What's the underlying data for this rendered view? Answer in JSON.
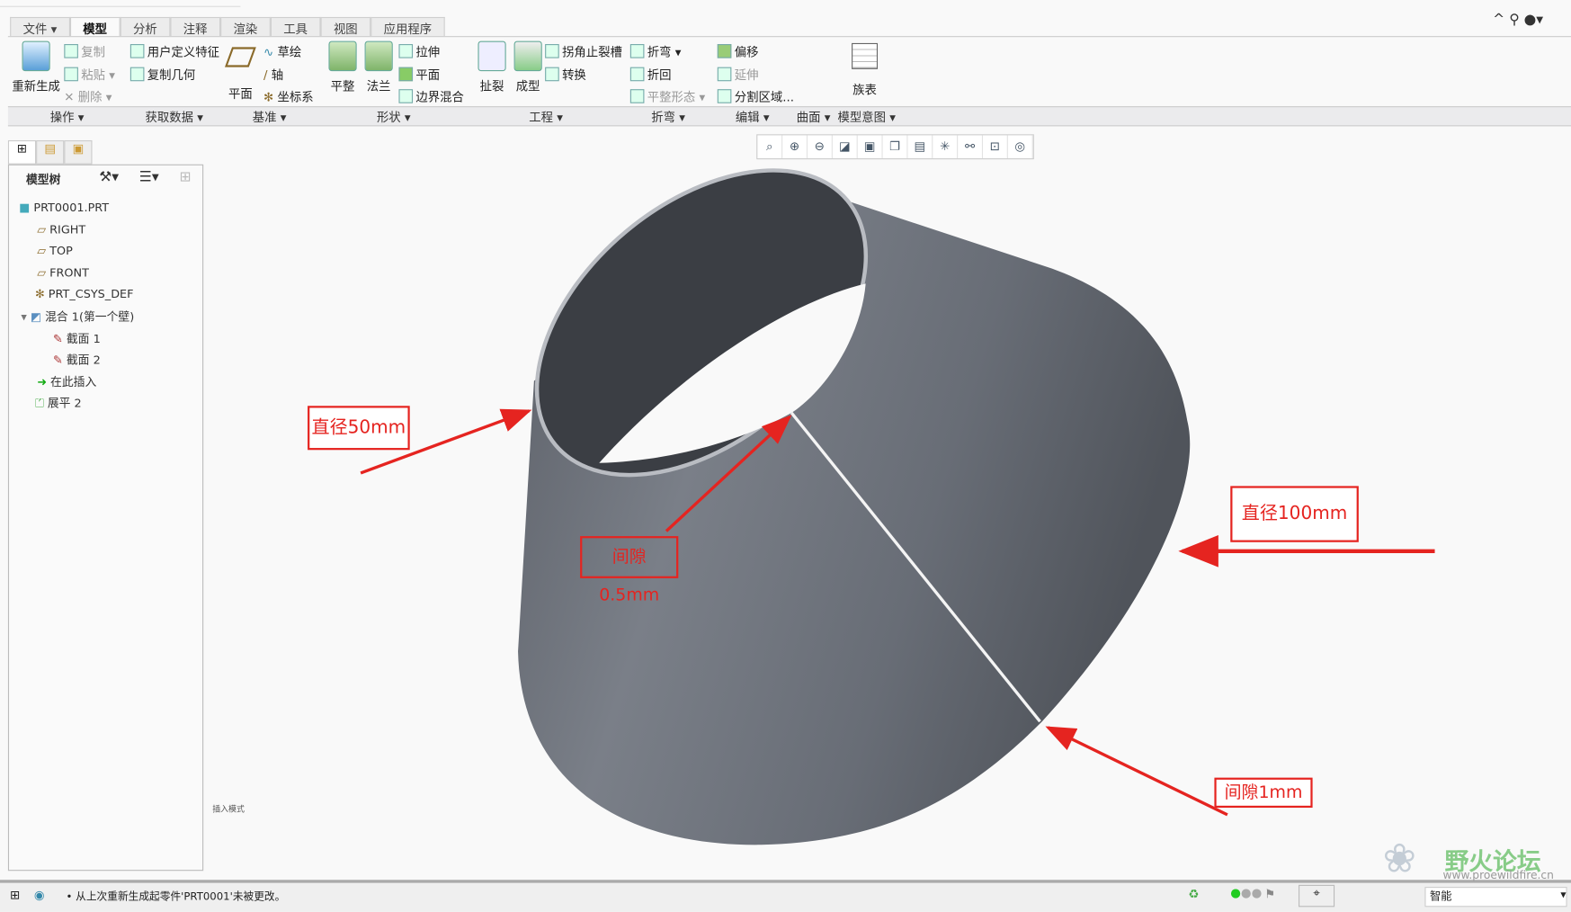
{
  "menu_tabs": [
    {
      "label": "文件 ▾"
    },
    {
      "label": "模型"
    },
    {
      "label": "分析"
    },
    {
      "label": "注释"
    },
    {
      "label": "渲染"
    },
    {
      "label": "工具"
    },
    {
      "label": "视图"
    },
    {
      "label": "应用程序"
    }
  ],
  "ribbon": {
    "operations": {
      "regenerate": "重新生成",
      "copy": "复制",
      "paste": "粘贴",
      "delete": "删除"
    },
    "get_data": {
      "udf": "用户定义特征",
      "copy_geom": "复制几何"
    },
    "datum": {
      "plane": "平面",
      "sketch": "草绘",
      "axis": "轴",
      "csys": "坐标系"
    },
    "shapes": {
      "planar": "平整",
      "flange": "法兰",
      "extrude": "拉伸",
      "flat": "平面",
      "boundary_blend": "边界混合"
    },
    "engineering": {
      "rip": "扯裂",
      "form": "成型",
      "corner_relief": "拐角止裂槽",
      "convert": "转换"
    },
    "bends": {
      "bend": "折弯",
      "unbend": "折回",
      "flat_state": "平整形态"
    },
    "editing": {
      "offset": "偏移",
      "extend": "延伸",
      "split_area": "分割区域..."
    },
    "family_table": "族表",
    "groups": [
      "操作 ▾",
      "获取数据 ▾",
      "基准 ▾",
      "形状 ▾",
      "工程 ▾",
      "折弯 ▾",
      "编辑 ▾",
      "曲面 ▾",
      "模型意图 ▾"
    ]
  },
  "view_toolbar": [
    "zoom-fit-icon",
    "zoom-in-icon",
    "zoom-out-icon",
    "repaint-icon",
    "display-style-icon",
    "saved-views-icon",
    "view-manager-icon",
    "datum-display-icon",
    "annotation-display-icon",
    "spin-center-icon",
    "appearance-icon"
  ],
  "model_tree": {
    "title": "模型树",
    "items": [
      {
        "label": "PRT0001.PRT",
        "icon": "part-icon"
      },
      {
        "label": "RIGHT",
        "icon": "plane-icon"
      },
      {
        "label": "TOP",
        "icon": "plane-icon"
      },
      {
        "label": "FRONT",
        "icon": "plane-icon"
      },
      {
        "label": "PRT_CSYS_DEF",
        "icon": "csys-icon"
      },
      {
        "label": "混合 1(第一个壁)",
        "icon": "blend-icon"
      },
      {
        "label": "截面 1",
        "icon": "sketch-icon"
      },
      {
        "label": "截面 2",
        "icon": "sketch-icon"
      },
      {
        "label": "在此插入",
        "icon": "insert-arrow-icon"
      },
      {
        "label": "展平 2",
        "icon": "unbend-icon"
      }
    ]
  },
  "viewport": {
    "mode_label": "插入模式",
    "annotations": {
      "dia50": "直径50mm",
      "dia100": "直径100mm",
      "gap05": "间隙0.5mm",
      "gap1": "间隙1mm"
    },
    "annotation_color": "#e52420",
    "model_color": "#6b7079"
  },
  "status": {
    "message": "从上次重新生成起零件'PRT0001'未被更改。",
    "filter": "智能"
  },
  "watermark": {
    "text": "野火论坛",
    "url": "www.proewildfire.cn"
  }
}
